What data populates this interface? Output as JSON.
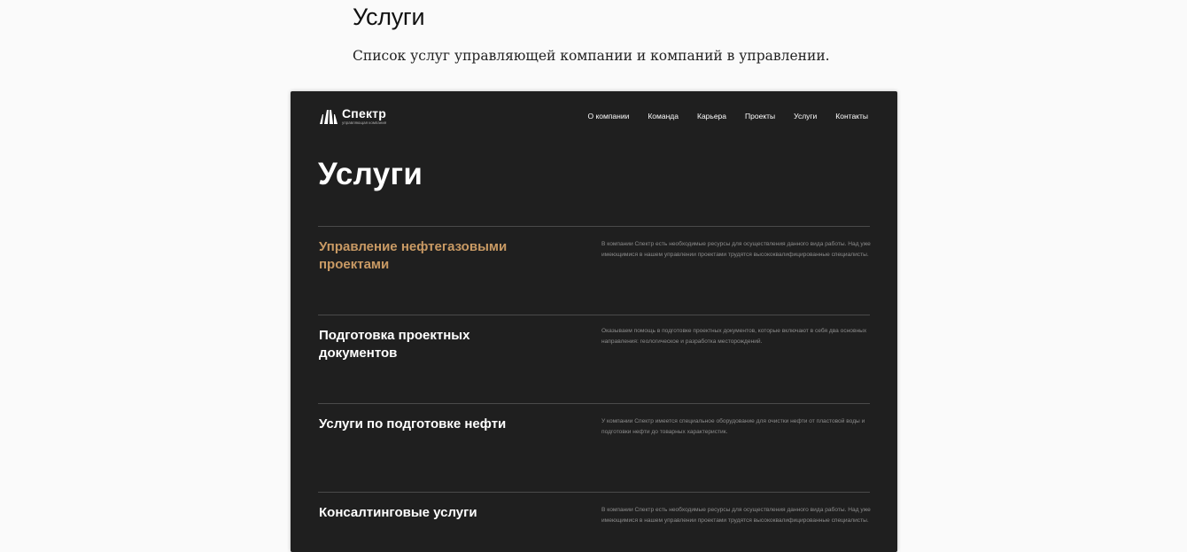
{
  "page": {
    "title": "Услуги",
    "subtitle": "Список услуг управляющей компании и компаний в управлении."
  },
  "site": {
    "logo": {
      "name": "Спектр",
      "tagline": "управляющая компания"
    },
    "nav": [
      "О компании",
      "Команда",
      "Карьера",
      "Проекты",
      "Услуги",
      "Контакты"
    ],
    "hero_title": "Услуги",
    "colors": {
      "background": "#1f1f1f",
      "accent": "#c99a64",
      "text": "#ffffff",
      "muted": "#8c8c8c"
    },
    "services": [
      {
        "title": "Управление нефтегазовыми проектами",
        "description": "В компании Спектр есть необходимые ресурсы для осуществления данного вида работы. Над уже имеющимися в нашем управлении проектами трудятся высококвалифицированные специалисты."
      },
      {
        "title": "Подготовка проектных документов",
        "description": "Оказываем помощь в подготовке проектных документов, которые включают в себя два основных направления: геологическое и разработка месторождений."
      },
      {
        "title": "Услуги по подготовке нефти",
        "description": "У компании Спектр имеется специальное оборудование для очистки нефти от пластовой воды и подготовки нефти до товарных характеристик."
      },
      {
        "title": "Консалтинговые услуги",
        "description": "В компании Спектр есть необходимые ресурсы для осуществления данного вида работы. Над уже имеющимися в нашем управлении проектами трудятся высококвалифицированные специалисты."
      }
    ]
  }
}
